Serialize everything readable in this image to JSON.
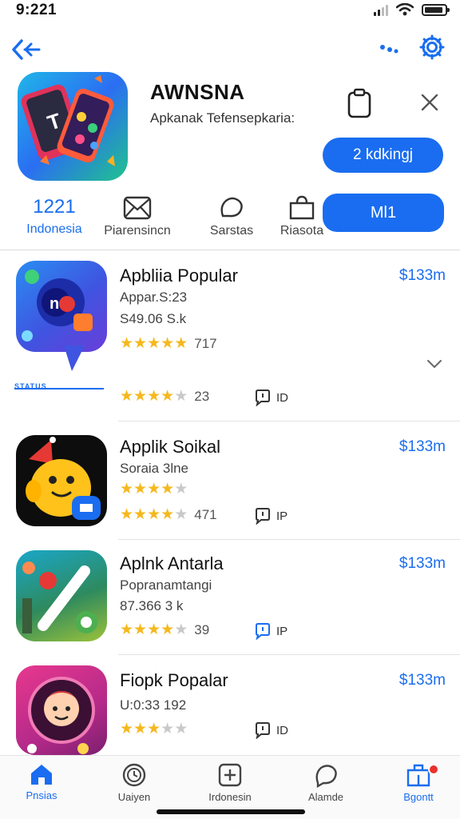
{
  "status_bar": {
    "time": "9:221"
  },
  "hero": {
    "title": "AWNSNA",
    "subtitle": "Apkanak Tefensepkaria:",
    "primary_button": "2 kdkingj",
    "secondary_button": "Ml1"
  },
  "tabs": [
    {
      "number": "1221",
      "label": "Indonesia"
    },
    {
      "label": "Piarensincn"
    },
    {
      "label": "Sarstas"
    },
    {
      "label": "Riasota"
    }
  ],
  "apps": [
    {
      "name": "Apbliia Popular",
      "price": "$133m",
      "line1": "Appar.S:23",
      "line2": "S49.06 S.k",
      "rating_top": "717",
      "rating_top_stars": 5,
      "rating_bottom": "23",
      "rating_bottom_stars": 4,
      "comments": "ID",
      "progress_text": "STATUS"
    },
    {
      "name": "Applik Soikal",
      "price": "$133m",
      "line1": "Soraia 3lne",
      "rating_top_stars": 4,
      "rating_bottom": "471",
      "rating_bottom_stars": 4,
      "comments": "IP"
    },
    {
      "name": "Aplnk Antarla",
      "price": "$133m",
      "line1": "Popranamtangi",
      "line2": "87.366 3 k",
      "rating_bottom": "39",
      "rating_bottom_stars": 4,
      "comments": "IP"
    },
    {
      "name": "Fiopk Popalar",
      "price": "$133m",
      "line1": "U:0:33 192",
      "rating_bottom_stars": 3,
      "comments": "ID"
    }
  ],
  "tab_bar": [
    {
      "label": "Pnsias",
      "icon": "home-icon"
    },
    {
      "label": "Uaiyen",
      "icon": "clock-icon"
    },
    {
      "label": "Irdonesin",
      "icon": "add-icon"
    },
    {
      "label": "Alamde",
      "icon": "chat-icon"
    },
    {
      "label": "Bgontt",
      "icon": "store-icon"
    }
  ],
  "colors": {
    "accent": "#1a6df0",
    "star": "#f5b81e",
    "badge": "#e8322d"
  }
}
